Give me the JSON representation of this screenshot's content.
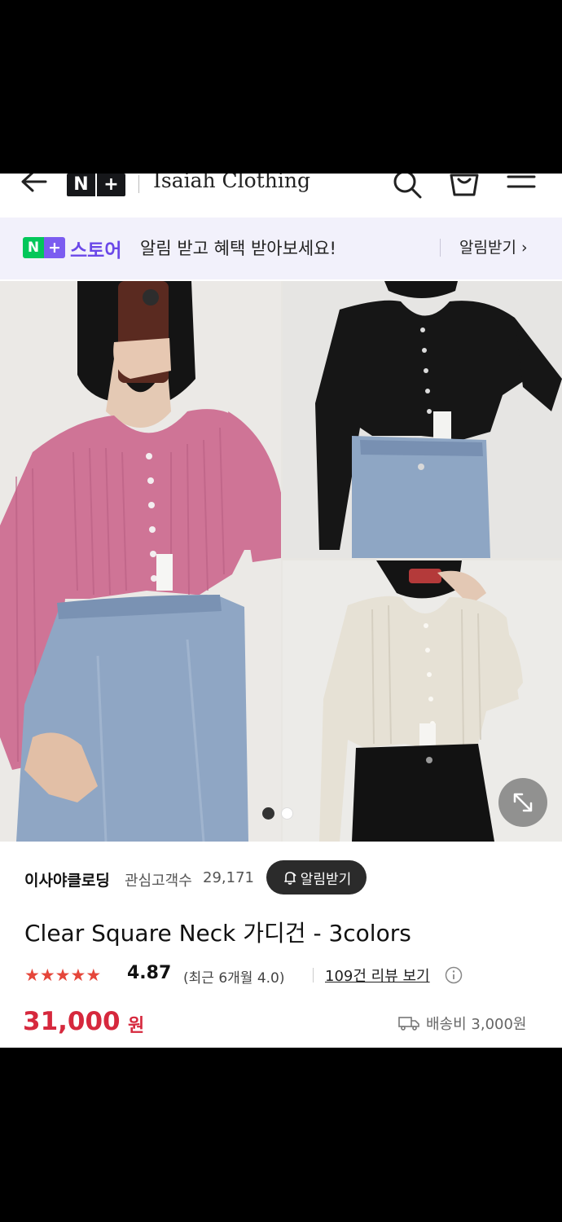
{
  "header": {
    "logo": [
      "N",
      "+"
    ],
    "store_name": "Isaiah Clothing"
  },
  "banner": {
    "logo": [
      "N",
      "+"
    ],
    "store_label": "스토어",
    "message": "알림 받고 혜택 받아보세요!",
    "action": "알림받기 ›"
  },
  "gallery": {
    "page_count": 2,
    "current_page": 1
  },
  "seller": {
    "name": "이사야클로딩",
    "followers_label": "관심고객수",
    "followers_count": "29,171",
    "follow_button": "알림받기"
  },
  "product": {
    "title": "Clear Square Neck 가디건 - 3colors",
    "stars": 5,
    "rating": "4.87",
    "recent": "(최근 6개월 4.0)",
    "reviews": "109건 리뷰 보기",
    "price": "31,000",
    "price_unit": "원",
    "shipping": "배송비 3,000원"
  },
  "colors": {
    "price": "#d6283d",
    "star": "#e5463a",
    "store_purple": "#6b48e8",
    "naver_green": "#03c75a",
    "banner_bg": "#f2f1fb"
  },
  "icons": [
    "back-arrow-icon",
    "search-icon",
    "cart-icon",
    "menu-icon",
    "expand-icon",
    "bell-icon",
    "info-icon",
    "truck-icon"
  ]
}
